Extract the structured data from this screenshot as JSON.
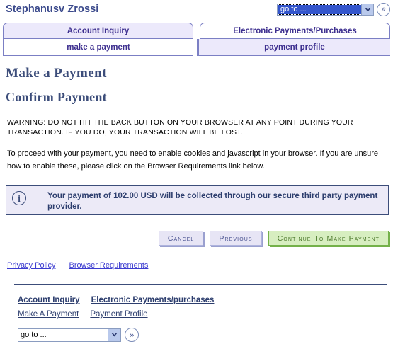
{
  "header": {
    "user_name": "Stephanusv Zrossi",
    "goto_select": {
      "value": "go to ...",
      "state": "focused",
      "arrow_icon": "chevron-down-icon"
    },
    "go_button": {
      "icon": "double-chevron-right-icon",
      "label": "»"
    }
  },
  "tabs": {
    "primary": [
      {
        "label": "Account Inquiry",
        "active": false
      },
      {
        "label": "Electronic Payments/Purchases",
        "active": true
      }
    ],
    "secondary": [
      {
        "label": "make a payment",
        "active": true
      },
      {
        "label": "payment profile",
        "active": false
      }
    ]
  },
  "main": {
    "page_title": "Make a Payment",
    "section_title": "Confirm Payment",
    "warning_text": "WARNING:  DO NOT HIT THE BACK BUTTON ON YOUR BROWSER AT ANY POINT DURING YOUR TRANSACTION.  IF YOU DO, YOUR TRANSACTION WILL BE LOST.",
    "paragraph_text": "To proceed with your payment, you need to enable cookies and javascript in your browser.  If you are unsure how to enable these, please click on the Browser Requirements link below.",
    "info_box": {
      "icon": "info-circle-icon",
      "icon_glyph": "i",
      "message": "Your payment of 102.00 USD will be collected through our secure third party payment provider.",
      "amount": "102.00",
      "currency": "USD",
      "border_color": "#3c4d7a",
      "background_color": "#eceaf7"
    },
    "buttons": [
      {
        "label": "Cancel",
        "style": "default"
      },
      {
        "label": "Previous",
        "style": "default"
      },
      {
        "label": "Continue To Make Payment",
        "style": "primary",
        "accent_color": "#74b14a"
      }
    ]
  },
  "footer": {
    "links": [
      {
        "label": "Privacy Policy"
      },
      {
        "label": "Browser Requirements"
      }
    ],
    "nav_row1": [
      {
        "label": "Account Inquiry"
      },
      {
        "label": "Electronic Payments/purchases"
      }
    ],
    "nav_row2": [
      {
        "label": "Make A Payment"
      },
      {
        "label": "Payment Profile"
      }
    ],
    "goto_select": {
      "value": "go to ...",
      "state": "normal",
      "arrow_icon": "chevron-down-icon"
    },
    "go_button": {
      "icon": "double-chevron-right-icon",
      "label": "»"
    }
  }
}
